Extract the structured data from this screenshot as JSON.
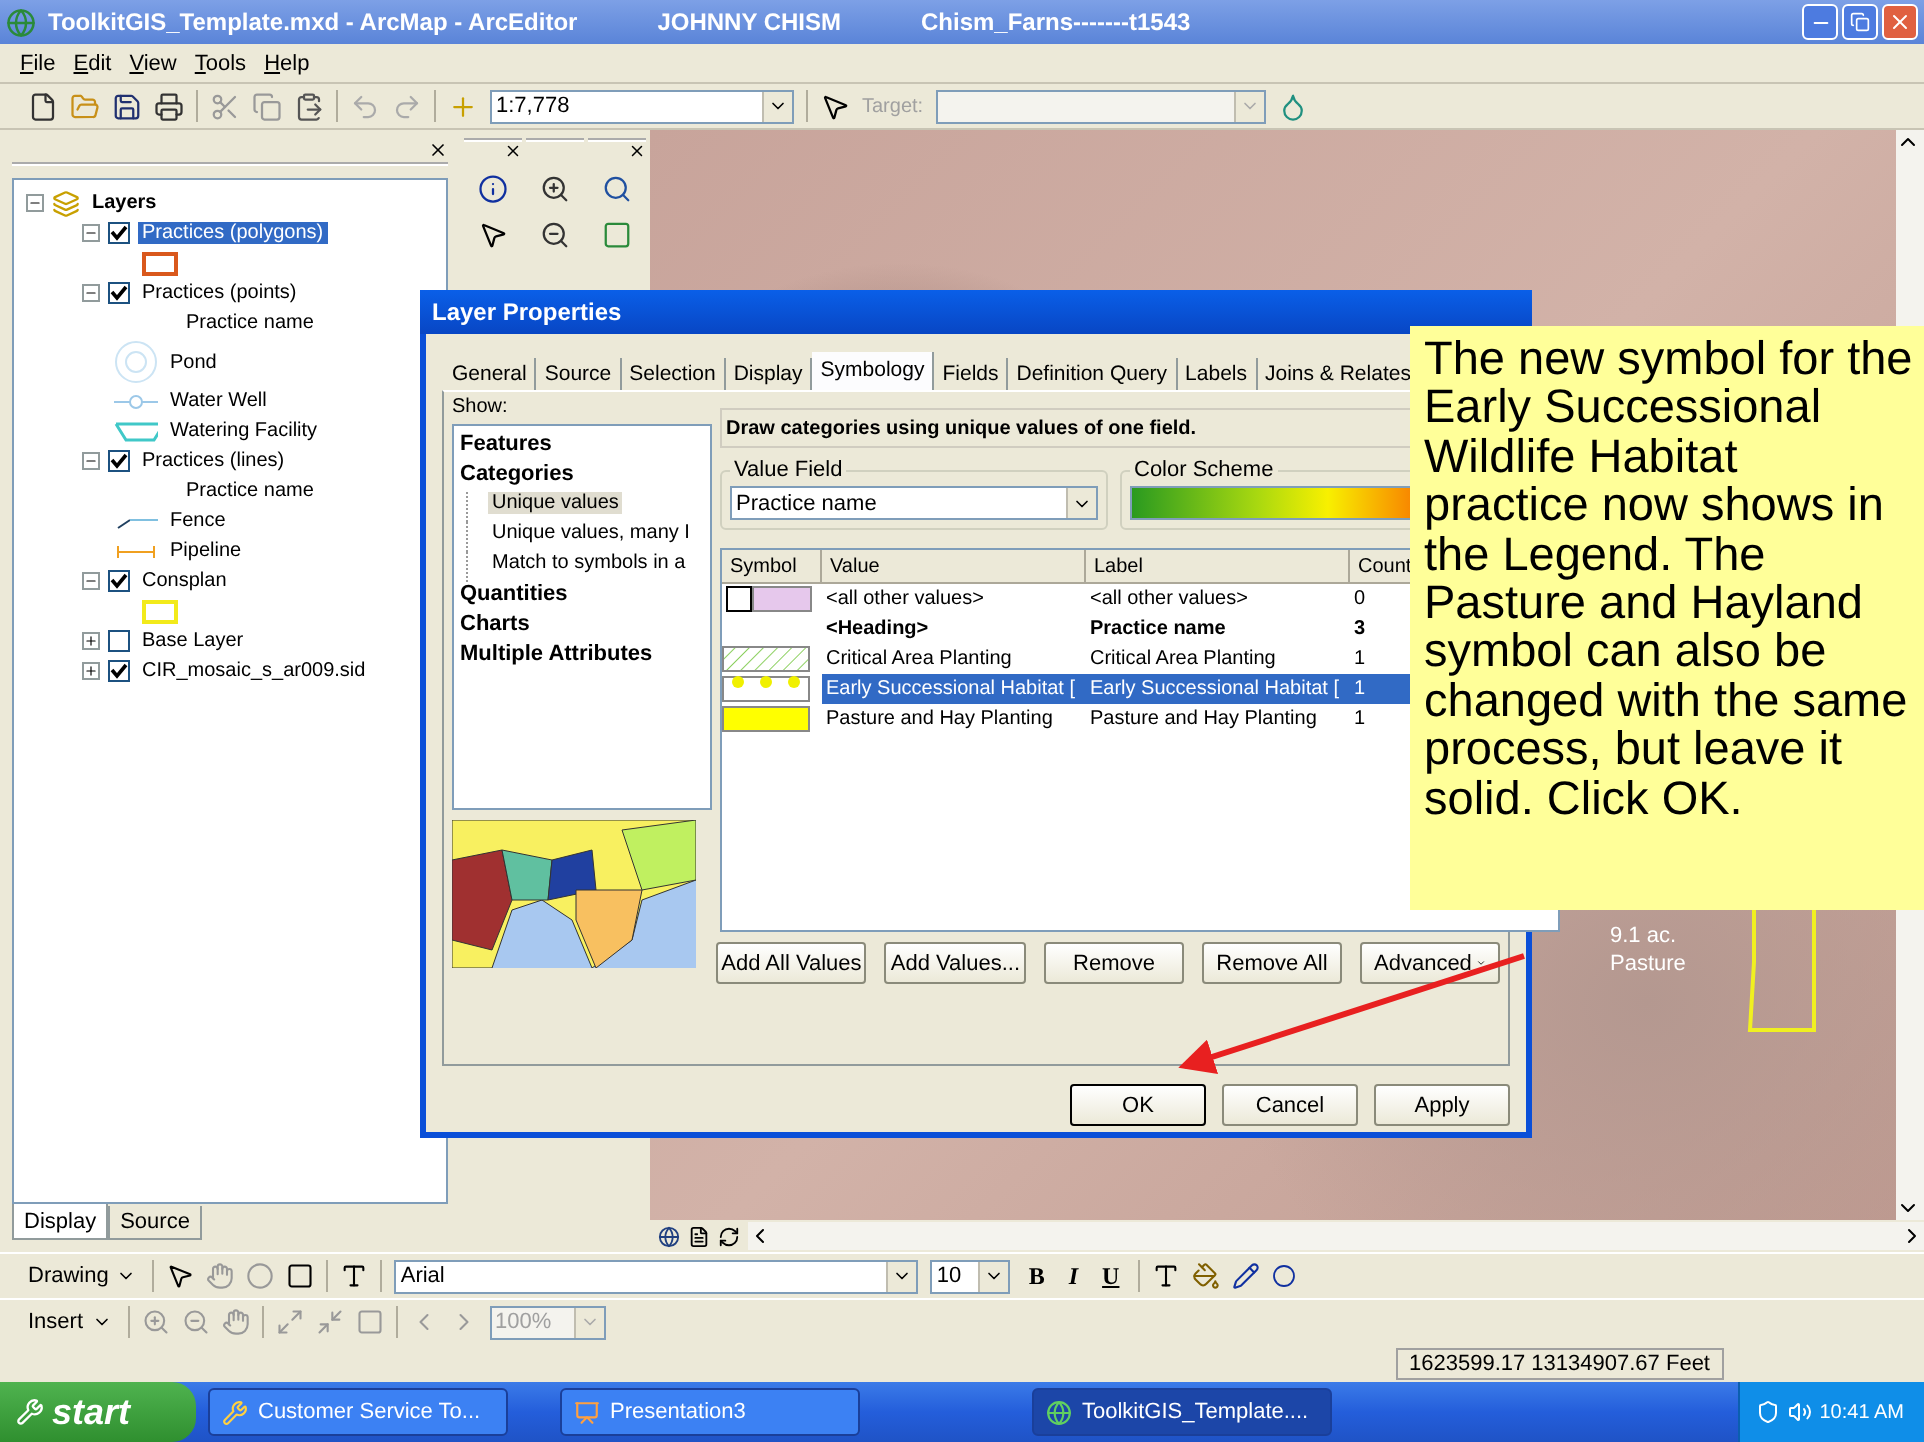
{
  "window": {
    "title_parts": [
      "ToolkitGIS_Template.mxd - ArcMap - ArcEditor",
      "JOHNNY CHISM",
      "Chism_Farns-------t1543"
    ]
  },
  "menu": [
    "File",
    "Edit",
    "View",
    "Tools",
    "Help"
  ],
  "toolbar": {
    "scale": "1:7,778",
    "target_label": "Target:"
  },
  "toc": {
    "root": {
      "label": "Layers",
      "expanded": true
    },
    "layers": [
      {
        "label": "Practices (polygons)",
        "checked": true,
        "expanded": true,
        "selected": true,
        "legend": [
          {
            "kind": "rect",
            "color": "#d9581c"
          }
        ]
      },
      {
        "label": "Practices (points)",
        "checked": true,
        "expanded": true,
        "selected": false,
        "legend": [
          {
            "kind": "heading",
            "label": "Practice name"
          },
          {
            "kind": "ring",
            "label": "Pond"
          },
          {
            "kind": "point",
            "label": "Water Well"
          },
          {
            "kind": "trough",
            "label": "Watering Facility"
          }
        ]
      },
      {
        "label": "Practices (lines)",
        "checked": true,
        "expanded": true,
        "selected": false,
        "legend": [
          {
            "kind": "heading",
            "label": "Practice name"
          },
          {
            "kind": "line",
            "label": "Fence"
          },
          {
            "kind": "dash",
            "label": "Pipeline"
          }
        ]
      },
      {
        "label": "Consplan",
        "checked": true,
        "expanded": true,
        "selected": false,
        "legend": [
          {
            "kind": "rect",
            "color": "#f2ea1a"
          }
        ]
      },
      {
        "label": "Base Layer",
        "checked": false,
        "expanded": false,
        "selected": false
      },
      {
        "label": "CIR_mosaic_s_ar009.sid",
        "checked": true,
        "expanded": false,
        "selected": false
      }
    ],
    "tabs": [
      {
        "label": "Display",
        "selected": true
      },
      {
        "label": "Source",
        "selected": false
      }
    ]
  },
  "map": {
    "labels": [
      "9.1 ac.",
      "Pasture"
    ]
  },
  "dialog": {
    "title": "Layer Properties",
    "tabs": [
      {
        "label": "General",
        "selected": false
      },
      {
        "label": "Source",
        "selected": false
      },
      {
        "label": "Selection",
        "selected": false
      },
      {
        "label": "Display",
        "selected": false
      },
      {
        "label": "Symbology",
        "selected": true
      },
      {
        "label": "Fields",
        "selected": false
      },
      {
        "label": "Definition Query",
        "selected": false
      },
      {
        "label": "Labels",
        "selected": false
      },
      {
        "label": "Joins & Relates",
        "selected": false
      }
    ],
    "show_label": "Show:",
    "show_items": [
      {
        "label": "Features",
        "selected": false
      },
      {
        "label": "Categories",
        "selected": false,
        "children": [
          {
            "label": "Unique values",
            "selected": true
          },
          {
            "label": "Unique values, many I",
            "selected": false
          },
          {
            "label": "Match to symbols in a",
            "selected": false
          }
        ]
      },
      {
        "label": "Quantities",
        "selected": false
      },
      {
        "label": "Charts",
        "selected": false
      },
      {
        "label": "Multiple Attributes",
        "selected": false
      }
    ],
    "description": "Draw categories using unique values of one field.",
    "value_field": {
      "legend": "Value Field",
      "value": "Practice name"
    },
    "color_scheme": {
      "legend": "Color Scheme"
    },
    "table": {
      "columns": [
        "Symbol",
        "Value",
        "Label",
        "Count"
      ],
      "rows": [
        {
          "kind": "other",
          "cells": [
            "",
            "<all other values>",
            "<all other values>",
            "0"
          ],
          "selected": false
        },
        {
          "kind": "heading",
          "cells": [
            "",
            "<Heading>",
            "Practice name",
            "3"
          ],
          "selected": false
        },
        {
          "kind": "hatch",
          "cells": [
            "",
            "Critical Area Planting",
            "Critical Area Planting",
            "1"
          ],
          "selected": false
        },
        {
          "kind": "dots",
          "cells": [
            "",
            "Early Successional Habitat [",
            "Early Successional Habitat [",
            "1"
          ],
          "selected": true
        },
        {
          "kind": "fill",
          "cells": [
            "",
            "Pasture and Hay Planting",
            "Pasture and Hay Planting",
            "1"
          ],
          "selected": false
        }
      ]
    },
    "buttons": [
      {
        "label": "Add All Values",
        "menu": false
      },
      {
        "label": "Add Values...",
        "menu": false
      },
      {
        "label": "Remove",
        "menu": false
      },
      {
        "label": "Remove All",
        "menu": false
      },
      {
        "label": "Advanced",
        "menu": true
      }
    ],
    "footer_buttons": [
      {
        "label": "OK",
        "default": true
      },
      {
        "label": "Cancel",
        "default": false
      },
      {
        "label": "Apply",
        "default": false
      }
    ]
  },
  "callout": {
    "text": "The new symbol for the Early Successional Wildlife Habitat practice now shows in the Legend. The Pasture and Hayland symbol can also be changed with the same process, but leave it solid. Click OK."
  },
  "drawing_toolbar": {
    "menu": "Drawing",
    "font": "Arial",
    "font_size": "10",
    "format_buttons": [
      "B",
      "I",
      "U"
    ]
  },
  "insert_toolbar": {
    "menu": "Insert",
    "zoom": "100%"
  },
  "status_bar": {
    "coordinates": "1623599.17  13134907.67 Feet"
  },
  "taskbar": {
    "start": "start",
    "tasks": [
      {
        "label": "Customer Service To...",
        "selected": false
      },
      {
        "label": "Presentation3",
        "selected": false
      },
      {
        "label": "ToolkitGIS_Template....",
        "selected": true
      }
    ],
    "clock": "10:41 AM"
  }
}
